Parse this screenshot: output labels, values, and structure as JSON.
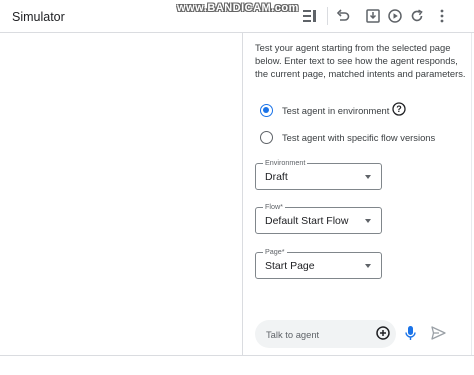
{
  "header": {
    "title": "Simulator",
    "watermark": "www.BANDICAM.com",
    "toolbar_icons": [
      "list-layout-icon",
      "undo-icon",
      "download-icon",
      "play-icon",
      "refresh-icon",
      "more-vert-icon"
    ]
  },
  "panel": {
    "description": "Test your agent starting from the selected page below. Enter text to see how the agent responds, the current page, matched intents and parameters.",
    "radios": [
      {
        "label": "Test agent in environment",
        "checked": true
      },
      {
        "label": "Test agent with specific flow versions",
        "checked": false
      }
    ],
    "help_icon": "help-icon",
    "fields": {
      "environment": {
        "label": "Environment",
        "value": "Draft"
      },
      "flow": {
        "label": "Flow*",
        "value": "Default Start Flow"
      },
      "page": {
        "label": "Page*",
        "value": "Start Page"
      }
    }
  },
  "chat": {
    "placeholder": "Talk to agent",
    "icons": [
      "add-circle-icon",
      "mic-icon",
      "send-icon"
    ]
  },
  "colors": {
    "accent": "#1a73e8",
    "border": "#dadce0",
    "text": "#202124",
    "muted": "#5f6368",
    "chat_bg": "#f1f3f4"
  }
}
